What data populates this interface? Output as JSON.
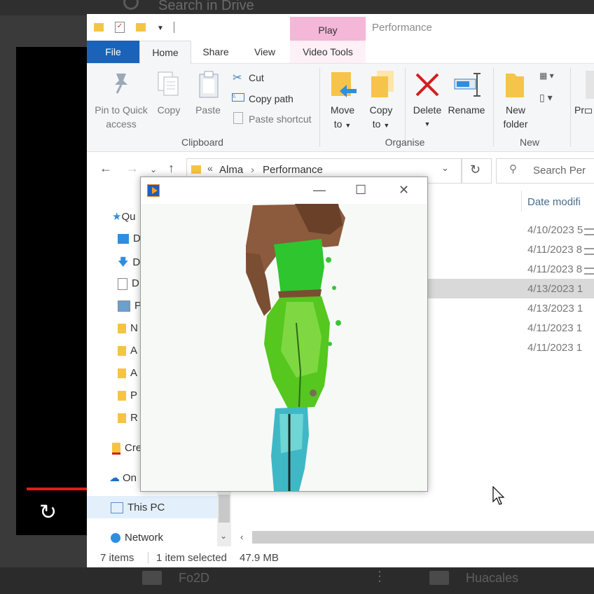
{
  "background": {
    "search_placeholder": "Search in Drive",
    "folder_left": "Fo2D",
    "folder_right": "Huacales",
    "more_icon": "⋮"
  },
  "titlebar": {
    "contextual_tab": "Play",
    "window_title": "Performance",
    "contextual_color": "#f4b7d8"
  },
  "ribbon_tabs": {
    "file": "File",
    "home": "Home",
    "share": "Share",
    "view": "View",
    "video_tools": "Video Tools"
  },
  "clipboard": {
    "pin": "Pin to Quick access",
    "pin_line1": "Pin to Quick",
    "pin_line2": "access",
    "copy": "Copy",
    "paste": "Paste",
    "cut": "Cut",
    "copy_path": "Copy path",
    "paste_shortcut": "Paste shortcut",
    "group": "Clipboard"
  },
  "organise": {
    "move_to_1": "Move",
    "move_to_2": "to",
    "copy_to_1": "Copy",
    "copy_to_2": "to",
    "delete": "Delete",
    "rename": "Rename",
    "group": "Organise"
  },
  "new_group": {
    "new_folder_1": "New",
    "new_folder_2": "folder",
    "group": "New",
    "properties_partial": "Pr"
  },
  "address": {
    "prefix": "«",
    "crumb1": "Alma",
    "sep": "›",
    "crumb2": "Performance",
    "search_placeholder": "Search Per"
  },
  "nav_pane": {
    "quick_access": "Qu",
    "items": [
      "D",
      "D",
      "D",
      "P",
      "N",
      "A",
      "A",
      "P",
      "R"
    ],
    "creative_cloud": "Cre",
    "onedrive": "On",
    "this_pc": "This PC",
    "network": "Network"
  },
  "file_list": {
    "date_header": "Date modifi",
    "dates": [
      "4/10/2023 5",
      "4/11/2023 8",
      "4/11/2023 8",
      "4/13/2023 1",
      "4/13/2023 1",
      "4/11/2023 1",
      "4/11/2023 1"
    ],
    "selected_index": 3
  },
  "status": {
    "items": "7 items",
    "selected": "1 item selected",
    "size": "47.9 MB"
  },
  "player": {
    "minimize": "—",
    "maximize": "☐",
    "close": "✕"
  }
}
